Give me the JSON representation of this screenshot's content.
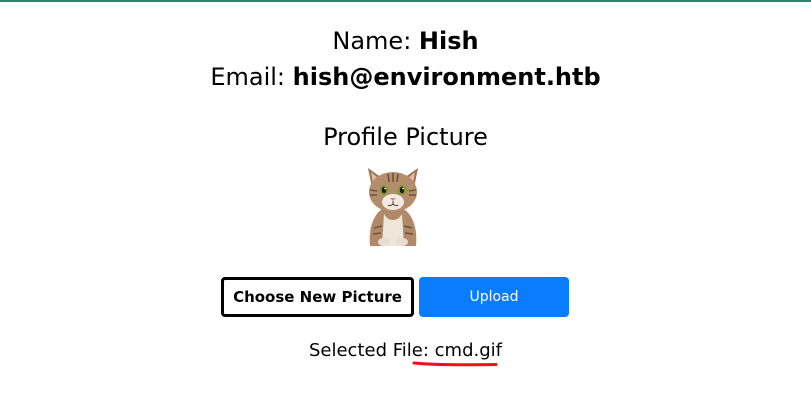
{
  "profile": {
    "name_label": "Name:",
    "name_value": "Hish",
    "email_label": "Email:",
    "email_value": "hish@environment.htb",
    "picture_heading": "Profile Picture"
  },
  "actions": {
    "choose_label": "Choose New Picture",
    "upload_label": "Upload"
  },
  "selection": {
    "label": "Selected File:",
    "filename": "cmd.gif"
  },
  "colors": {
    "top_border": "#1f8a70",
    "upload_button": "#0a7cff",
    "annotation": "#e8141b"
  }
}
